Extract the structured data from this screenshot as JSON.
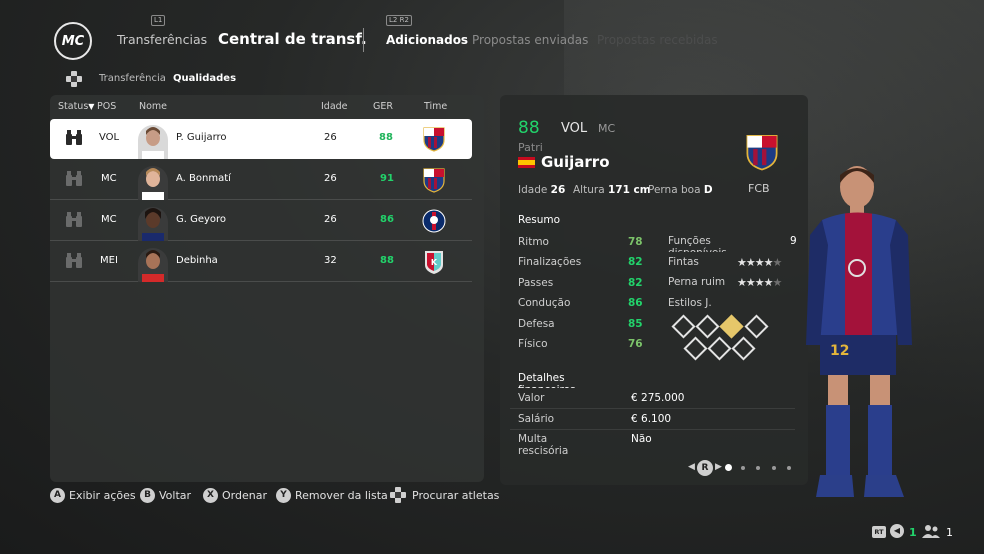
{
  "header": {
    "logo_text": "MC",
    "nav_hint_left": "L1",
    "nav_hint_mid": "L2  R2",
    "nav_transfers": "Transferências",
    "nav_central": "Central de transf.",
    "tabs": [
      "Adicionados",
      "Propostas enviadas",
      "Propostas recebidas"
    ]
  },
  "subnav": {
    "items": [
      "Transferência",
      "Qualidades"
    ]
  },
  "table": {
    "columns": [
      "Status",
      "POS",
      "Nome",
      "Idade",
      "GER",
      "Time"
    ],
    "sort_arrow": "▼",
    "rows": [
      {
        "pos": "VOL",
        "name": "P. Guijarro",
        "age": "26",
        "ger": "88",
        "team": "barcelona-crest"
      },
      {
        "pos": "MC",
        "name": "A. Bonmatí",
        "age": "26",
        "ger": "91",
        "team": "barcelona-crest"
      },
      {
        "pos": "MC",
        "name": "G. Geyoro",
        "age": "26",
        "ger": "86",
        "team": "psg-crest"
      },
      {
        "pos": "MEI",
        "name": "Debinha",
        "age": "32",
        "ger": "88",
        "team": "kc-current-crest"
      }
    ]
  },
  "card": {
    "ovr": "88",
    "pos_main": "VOL",
    "pos_alt": "MC",
    "first_name": "Patri",
    "last_name": "Guijarro",
    "age_label": "Idade",
    "age": "26",
    "height_label": "Altura",
    "height": "171 cm",
    "foot_label": "Perna boa",
    "foot": "D",
    "club_short": "FCB",
    "summary_title": "Resumo",
    "stats": [
      {
        "label": "Ritmo",
        "value": "78"
      },
      {
        "label": "Finalizações",
        "value": "82"
      },
      {
        "label": "Passes",
        "value": "82"
      },
      {
        "label": "Condução",
        "value": "86"
      },
      {
        "label": "Defesa",
        "value": "85"
      },
      {
        "label": "Físico",
        "value": "76"
      }
    ],
    "roles_label": "Funções disponíveis",
    "roles_value": "9",
    "skill_label": "Fintas",
    "skill_stars": 4,
    "weakfoot_label": "Perna ruim",
    "weakfoot_stars": 4,
    "playstyles_label": "Estilos J.",
    "finance_title": "Detalhes financeiros",
    "finance": [
      {
        "label": "Valor",
        "value": "€ 275.000"
      },
      {
        "label": "Salário",
        "value": "€ 6.100"
      },
      {
        "label": "Multa rescisória",
        "value": "Não"
      }
    ],
    "pager_button": "R",
    "pager_pages": 5,
    "pager_active": 1
  },
  "footer": {
    "actions": [
      {
        "button": "A",
        "label": "Exibir ações"
      },
      {
        "button": "B",
        "label": "Voltar"
      },
      {
        "button": "X",
        "label": "Ordenar"
      },
      {
        "button": "Y",
        "label": "Remover da lista"
      },
      {
        "button": "dpad",
        "label": "Procurar atletas"
      }
    ],
    "rt_label": "RT",
    "count_left": "1",
    "count_right": "1"
  },
  "colors": {
    "ger_green": "#22d36b",
    "stat_yellow_green": "#7cc36a",
    "row_selected_bg": "#ffffff",
    "barca_blue": "#1c3b85",
    "barca_red": "#a3123a"
  }
}
